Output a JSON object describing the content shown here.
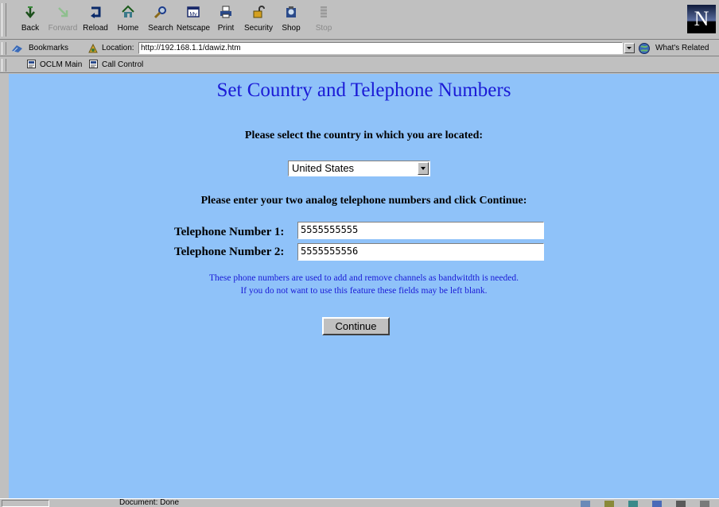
{
  "toolbar": {
    "buttons": [
      {
        "label": "Back",
        "icon": "back-arrow-icon",
        "enabled": true
      },
      {
        "label": "Forward",
        "icon": "forward-arrow-icon",
        "enabled": false
      },
      {
        "label": "Reload",
        "icon": "reload-icon",
        "enabled": true
      },
      {
        "label": "Home",
        "icon": "home-icon",
        "enabled": true
      },
      {
        "label": "Search",
        "icon": "search-icon",
        "enabled": true
      },
      {
        "label": "Netscape",
        "icon": "netscape-icon",
        "enabled": true
      },
      {
        "label": "Print",
        "icon": "print-icon",
        "enabled": true
      },
      {
        "label": "Security",
        "icon": "security-lock-icon",
        "enabled": true
      },
      {
        "label": "Shop",
        "icon": "shop-icon",
        "enabled": true
      },
      {
        "label": "Stop",
        "icon": "stop-icon",
        "enabled": false
      }
    ],
    "logo_letter": "N"
  },
  "location_bar": {
    "bookmarks_label": "Bookmarks",
    "location_label": "Location:",
    "url": "http://192.168.1.1/dawiz.htm",
    "whats_related_label": "What's Related"
  },
  "personal_toolbar": {
    "items": [
      "OCLM Main",
      "Call Control"
    ]
  },
  "page": {
    "title": "Set Country and Telephone Numbers",
    "country_prompt": "Please select the country in which you are located:",
    "country_selected": "United States",
    "phones_prompt": "Please enter your two analog telephone numbers and click Continue:",
    "tel1_label": "Telephone Number 1:",
    "tel1_value": "5555555555",
    "tel2_label": "Telephone Number 2:",
    "tel2_value": "5555555556",
    "help_line1": "These phone numbers are used to add and remove channels as bandwitdth is needed.",
    "help_line2": "If you do not want to use this feature these fields may be left blank.",
    "continue_label": "Continue"
  },
  "status_bar": {
    "text": "Document: Done"
  },
  "colors": {
    "content_background": "#8fc2f9",
    "title_text": "#1a1ad6",
    "chrome": "#c0c0c0"
  }
}
